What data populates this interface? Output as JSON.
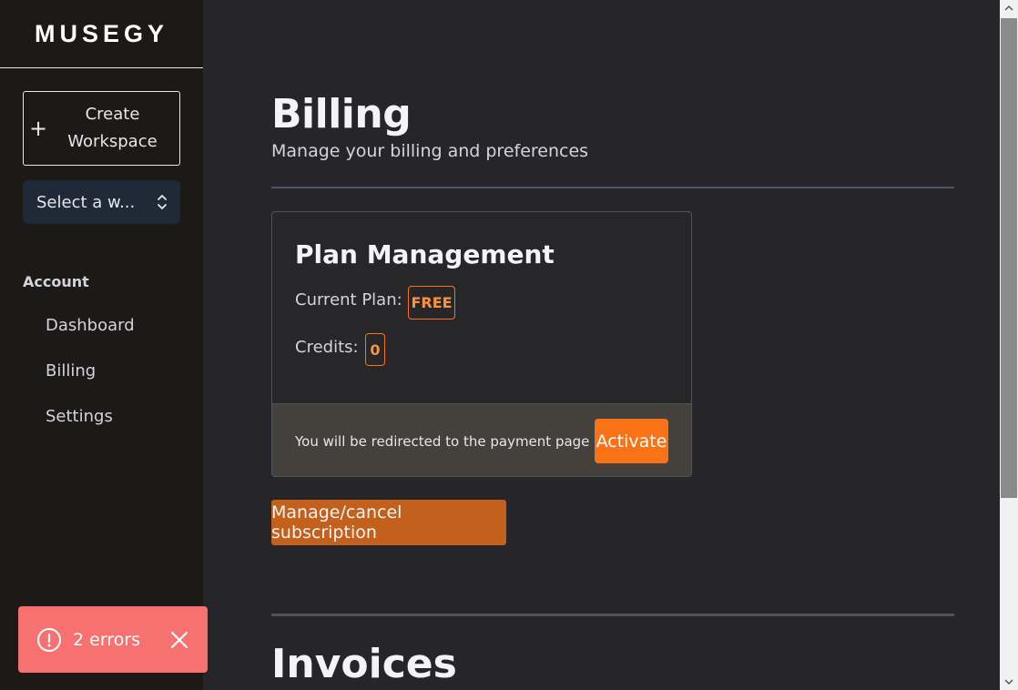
{
  "sidebar": {
    "logo": "MUSEGY",
    "create_workspace": {
      "icon": "plus-icon",
      "label": "Create Workspace"
    },
    "workspace_select": {
      "value": "Select a w...",
      "icon": "chevron-up-down-icon"
    },
    "section_title": "Account",
    "nav": [
      {
        "label": "Dashboard"
      },
      {
        "label": "Billing"
      },
      {
        "label": "Settings"
      }
    ]
  },
  "main": {
    "title": "Billing",
    "subtitle": "Manage your billing and preferences",
    "plan_card": {
      "title": "Plan Management",
      "current_plan_label": "Current Plan:",
      "current_plan_value": "FREE",
      "credits_label": "Credits:",
      "credits_value": "0",
      "footer_text": "You will be redirected to the payment page",
      "activate_label": "Activate"
    },
    "manage_label": "Manage/cancel subscription",
    "invoices_title": "Invoices"
  },
  "toast": {
    "icon": "alert-circle-icon",
    "text": "2 errors",
    "close_icon": "close-icon"
  },
  "colors": {
    "accent": "#f97316",
    "sidebar_bg": "#1c1917",
    "main_bg": "#26262a",
    "toast_bg": "#f87171"
  }
}
